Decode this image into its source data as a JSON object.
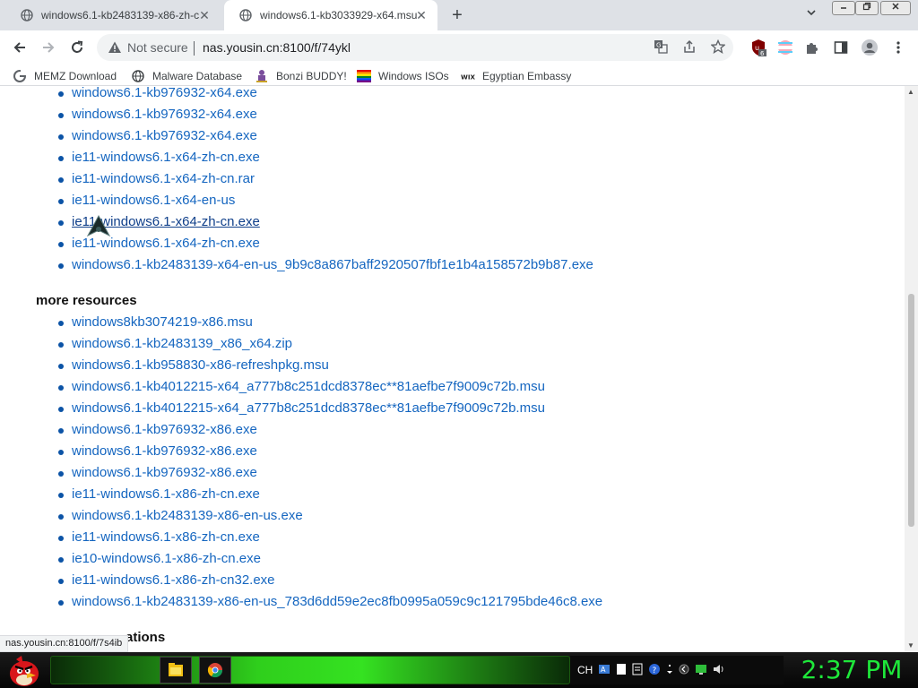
{
  "tabs": [
    {
      "title": "windows6.1-kb2483139-x86-zh-c",
      "close": "✕"
    },
    {
      "title": "windows6.1-kb3033929-x64.msu",
      "close": "✕"
    }
  ],
  "new_tab": "+",
  "toolbar": {
    "not_secure": "Not secure",
    "url": "nas.yousin.cn:8100/f/74ykl",
    "extension_badge": "6"
  },
  "bookmarks": [
    {
      "label": "MEMZ Download",
      "icon": "google-g-icon"
    },
    {
      "label": "Malware Database",
      "icon": "globe-icon"
    },
    {
      "label": "Bonzi BUDDY!",
      "icon": "gorilla-icon"
    },
    {
      "label": "Windows ISOs",
      "icon": "rainbow-flag-icon"
    },
    {
      "label": "Egyptian Embassy",
      "icon": "wix-icon"
    }
  ],
  "files_top": [
    "windows6.1-kb976932-x64.exe",
    "windows6.1-kb976932-x64.exe",
    "windows6.1-kb976932-x64.exe",
    "ie11-windows6.1-x64-zh-cn.exe",
    "ie11-windows6.1-x64-zh-cn.rar",
    "ie11-windows6.1-x64-en-us",
    "ie11-windows6.1-x64-zh-cn.exe",
    "ie11-windows6.1-x64-zh-cn.exe",
    "windows6.1-kb2483139-x64-en-us_9b9c8a867baff2920507fbf1e1b4a158572b9b87.exe"
  ],
  "hovered_index": 6,
  "section_more": "more resources",
  "files_more": [
    "windows8kb3074219-x86.msu",
    "windows6.1-kb2483139_x86_x64.zip",
    "windows6.1-kb958830-x86-refreshpkg.msu",
    "windows6.1-kb4012215-x64_a777b8c251dcd8378ec**81aefbe7f9009c72b.msu",
    "windows6.1-kb4012215-x64_a777b8c251dcd8378ec**81aefbe7f9009c72b.msu",
    "windows6.1-kb976932-x86.exe",
    "windows6.1-kb976932-x86.exe",
    "windows6.1-kb976932-x86.exe",
    "ie11-windows6.1-x86-zh-cn.exe",
    "windows6.1-kb2483139-x86-en-us.exe",
    "ie11-windows6.1-x86-zh-cn.exe",
    "ie10-windows6.1-x86-zh-cn.exe",
    "ie11-windows6.1-x86-zh-cn32.exe",
    "windows6.1-kb2483139-x86-en-us_783d6dd59e2ec8fb0995a059c9c121795bde46c8.exe"
  ],
  "section_next": "ations",
  "status_url": "nas.yousin.cn:8100/f/7s4ib",
  "taskbar": {
    "language": "CH",
    "clock": "2:37 PM"
  },
  "colors": {
    "link": "#1566c0",
    "clock": "#1ee83a",
    "taskbar_green": "#35e221"
  }
}
